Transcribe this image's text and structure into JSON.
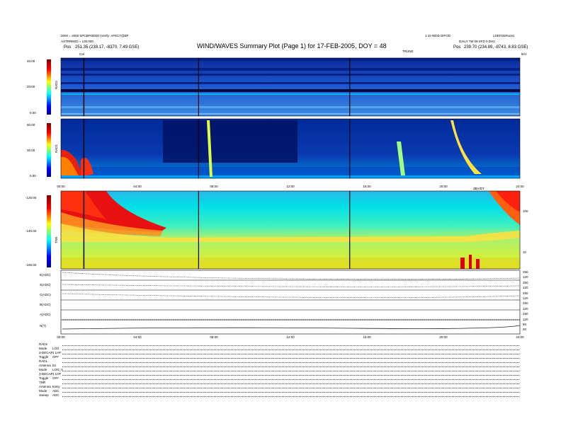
{
  "header": {
    "title": "WIND/WAVES Summary Plot (Page 1) for 17-FEB-2005, DOY = 48",
    "left_line1": "0000 = 2000 SPCBF00000 (Verify- AFECT@BF",
    "left_line2": "ASTRREED = 130.000",
    "left_pos_label": "Pos",
    "left_pos_value": "251.35 (238.17, -8370, 7.49 GSE)",
    "right_line1": "1.10 WDD DIFOD",
    "right_line1b": "LDEFDD#uc81",
    "right_line2": "DAILY TM 09 SFD 0 DH2",
    "right_pos_label": "Pos",
    "right_pos_value": "239.70 (234.89, -8743, 8.83 GSE)",
    "cal_label": "Cal",
    "tnr_gain_label": "TRUNE",
    "khz_label": "kHz"
  },
  "panels": {
    "rad2": {
      "name": "RAD2",
      "ticks": [
        "40.00",
        "20.00",
        "0.00"
      ]
    },
    "rad1": {
      "name": "RAD1",
      "ticks": [
        "60.00",
        "30.00",
        "0.00"
      ]
    },
    "tnr": {
      "name": "TNR",
      "ticks": [
        "-125.00",
        "-140.00",
        "-155.00"
      ],
      "right_ticks": [
        "100",
        "10"
      ],
      "unit_label": "dBV/DT"
    }
  },
  "stacked_labels": [
    "E(ADC)",
    "S(ADC)",
    "C(ADC)",
    "B(ADC)",
    "A(ADC)",
    "N(T)"
  ],
  "stacked_right": [
    "250",
    "120",
    "250",
    "120",
    "250",
    "120",
    "250",
    "120",
    "250",
    "120",
    "50",
    "20"
  ],
  "notes": [
    {
      "group": "RAD2",
      "rows": [
        {
          "k": "Mode",
          "v": "LOG"
        },
        {
          "k": "3-DECAP",
          "v": "1 LHF"
        },
        {
          "k": "Toggle",
          "v": "OFF"
        }
      ]
    },
    {
      "group": "RAD1",
      "rows": [
        {
          "k": "Antenna",
          "v": "Ex"
        },
        {
          "k": "Mode",
          "v": "LOG_A"
        },
        {
          "k": "3-DECAP",
          "v": "1 LHF"
        },
        {
          "k": "Toggle",
          "v": "OFF"
        }
      ]
    },
    {
      "group": "TNR",
      "rows": [
        {
          "k": "Antenna",
          "v": "ExEy"
        },
        {
          "k": "Mode",
          "v": "ADC"
        },
        {
          "k": "Sweep",
          "v": "ADC"
        }
      ]
    }
  ],
  "chart_data": {
    "type": "heatmap",
    "title": "WIND/WAVES Summary Plot (Page 1) for 17-FEB-2005, DOY = 48",
    "x_axis": {
      "ticks": [
        "00:00",
        "04:00",
        "08:00",
        "12:00",
        "16:00",
        "20:00",
        "24:00"
      ],
      "range_hours": [
        0,
        24
      ]
    },
    "spectrograms": [
      {
        "name": "RAD2",
        "colorbar_range": [
          0,
          40
        ]
      },
      {
        "name": "RAD1",
        "colorbar_range": [
          0,
          60
        ]
      },
      {
        "name": "TNR",
        "colorbar_range": [
          -155,
          -125
        ]
      }
    ],
    "markers_hours": [
      1.2,
      7.2,
      15.1
    ],
    "colors": {
      "low": "#0000a0",
      "mid": "#00c0ff",
      "high": "#ff0000"
    }
  }
}
